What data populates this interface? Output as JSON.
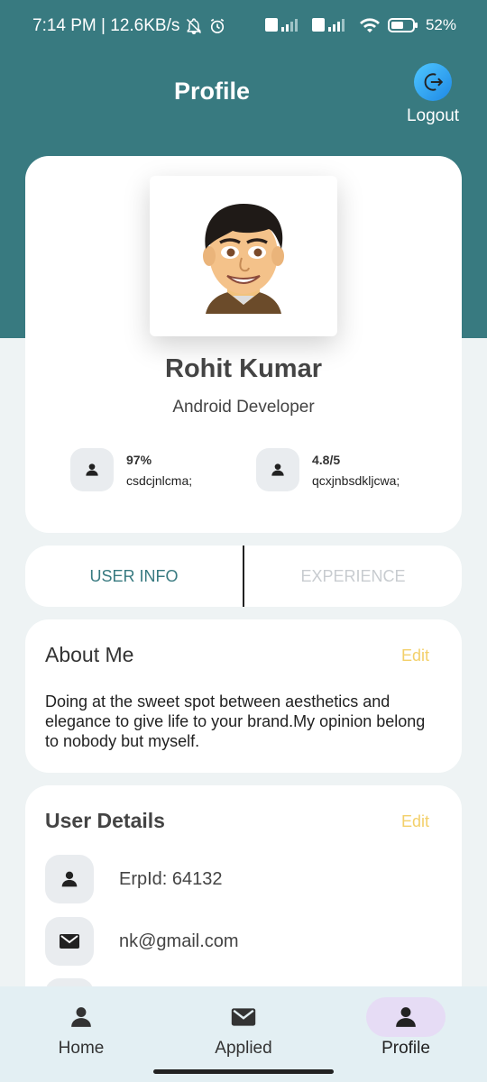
{
  "status_bar": {
    "time_speed": "7:14 PM | 12.6KB/s",
    "battery": "52%"
  },
  "header": {
    "title": "Profile",
    "logout_label": "Logout"
  },
  "profile": {
    "name": "Rohit Kumar",
    "role": "Android Developer",
    "stats": [
      {
        "value": "97%",
        "label": "csdcjnlcma;"
      },
      {
        "value": "4.8/5",
        "label": "qcxjnbsdkljcwa;"
      }
    ]
  },
  "tabs": [
    {
      "label": "USER INFO",
      "active": true
    },
    {
      "label": "EXPERIENCE",
      "active": false
    }
  ],
  "about": {
    "title": "About Me",
    "edit_label": "Edit",
    "text": "Doing at the sweet spot between aesthetics and elegance to give life to your brand.My opinion belong to nobody but myself."
  },
  "user_details": {
    "title": "User Details",
    "edit_label": "Edit",
    "rows": [
      {
        "icon": "person-icon",
        "text": "ErpId: 64132"
      },
      {
        "icon": "mail-icon",
        "text": "nk@gmail.com"
      }
    ]
  },
  "bottom_nav": [
    {
      "icon": "person-icon",
      "label": "Home",
      "active": false
    },
    {
      "icon": "mail-icon",
      "label": "Applied",
      "active": false
    },
    {
      "icon": "person-icon",
      "label": "Profile",
      "active": true
    }
  ],
  "colors": {
    "header": "#387a80",
    "edit": "#f3d06a",
    "active_tab": "#387a80",
    "nav_bg": "#e3eff3",
    "nav_active_pill": "#e6dcf5"
  }
}
